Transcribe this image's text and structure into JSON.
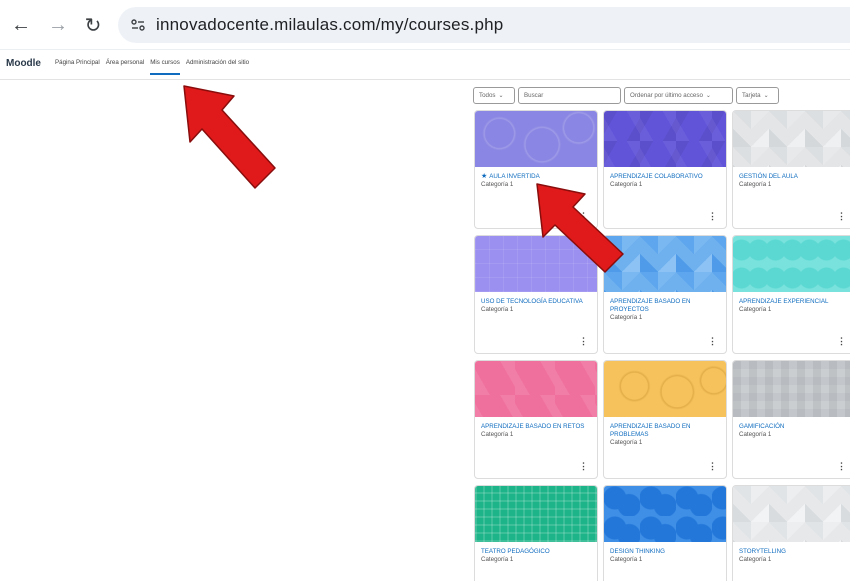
{
  "browser": {
    "url": "innovadocente.milaulas.com/my/courses.php"
  },
  "navbar": {
    "brand": "Moodle",
    "links": [
      "Página Principal",
      "Área personal",
      "Mis cursos",
      "Administración del sitio"
    ],
    "active_index": 2,
    "accent_color": "#0f6cbf"
  },
  "filters": {
    "grouping": "Todos",
    "search_placeholder": "Buscar",
    "sort": "Ordenar por último acceso",
    "view": "Tarjeta"
  },
  "courses": [
    {
      "title": "AULA INVERTIDA",
      "category": "Categoría 1",
      "starred": true,
      "pattern": "circles-purple"
    },
    {
      "title": "APRENDIZAJE COLABORATIVO",
      "category": "Categoría 1",
      "starred": false,
      "pattern": "hex-indigo"
    },
    {
      "title": "GESTIÓN DEL AULA",
      "category": "Categoría 1",
      "starred": false,
      "pattern": "tri-gray"
    },
    {
      "title": "USO DE TECNOLOGÍA EDUCATIVA",
      "category": "Categoría 1",
      "starred": false,
      "pattern": "squares-purple"
    },
    {
      "title": "APRENDIZAJE BASADO EN PROYECTOS",
      "category": "Categoría 1",
      "starred": false,
      "pattern": "tri-blue"
    },
    {
      "title": "APRENDIZAJE EXPERIENCIAL",
      "category": "Categoría 1",
      "starred": false,
      "pattern": "hex-teal"
    },
    {
      "title": "APRENDIZAJE BASADO EN RETOS",
      "category": "Categoría 1",
      "starred": false,
      "pattern": "pink"
    },
    {
      "title": "APRENDIZAJE BASADO EN PROBLEMAS",
      "category": "Categoría 1",
      "starred": false,
      "pattern": "circles-orange"
    },
    {
      "title": "GAMIFICACIÓN",
      "category": "Categoría 1",
      "starred": false,
      "pattern": "mosaic-gray"
    },
    {
      "title": "TEATRO PEDAGÓGICO",
      "category": "Categoría 1",
      "starred": false,
      "pattern": "plaid-green"
    },
    {
      "title": "DESIGN THINKING",
      "category": "Categoría 1",
      "starred": false,
      "pattern": "hex-blue"
    },
    {
      "title": "STORYTELLING",
      "category": "Categoría 1",
      "starred": false,
      "pattern": "tri-lightgray"
    }
  ],
  "annotation_color": "#e01a1a"
}
